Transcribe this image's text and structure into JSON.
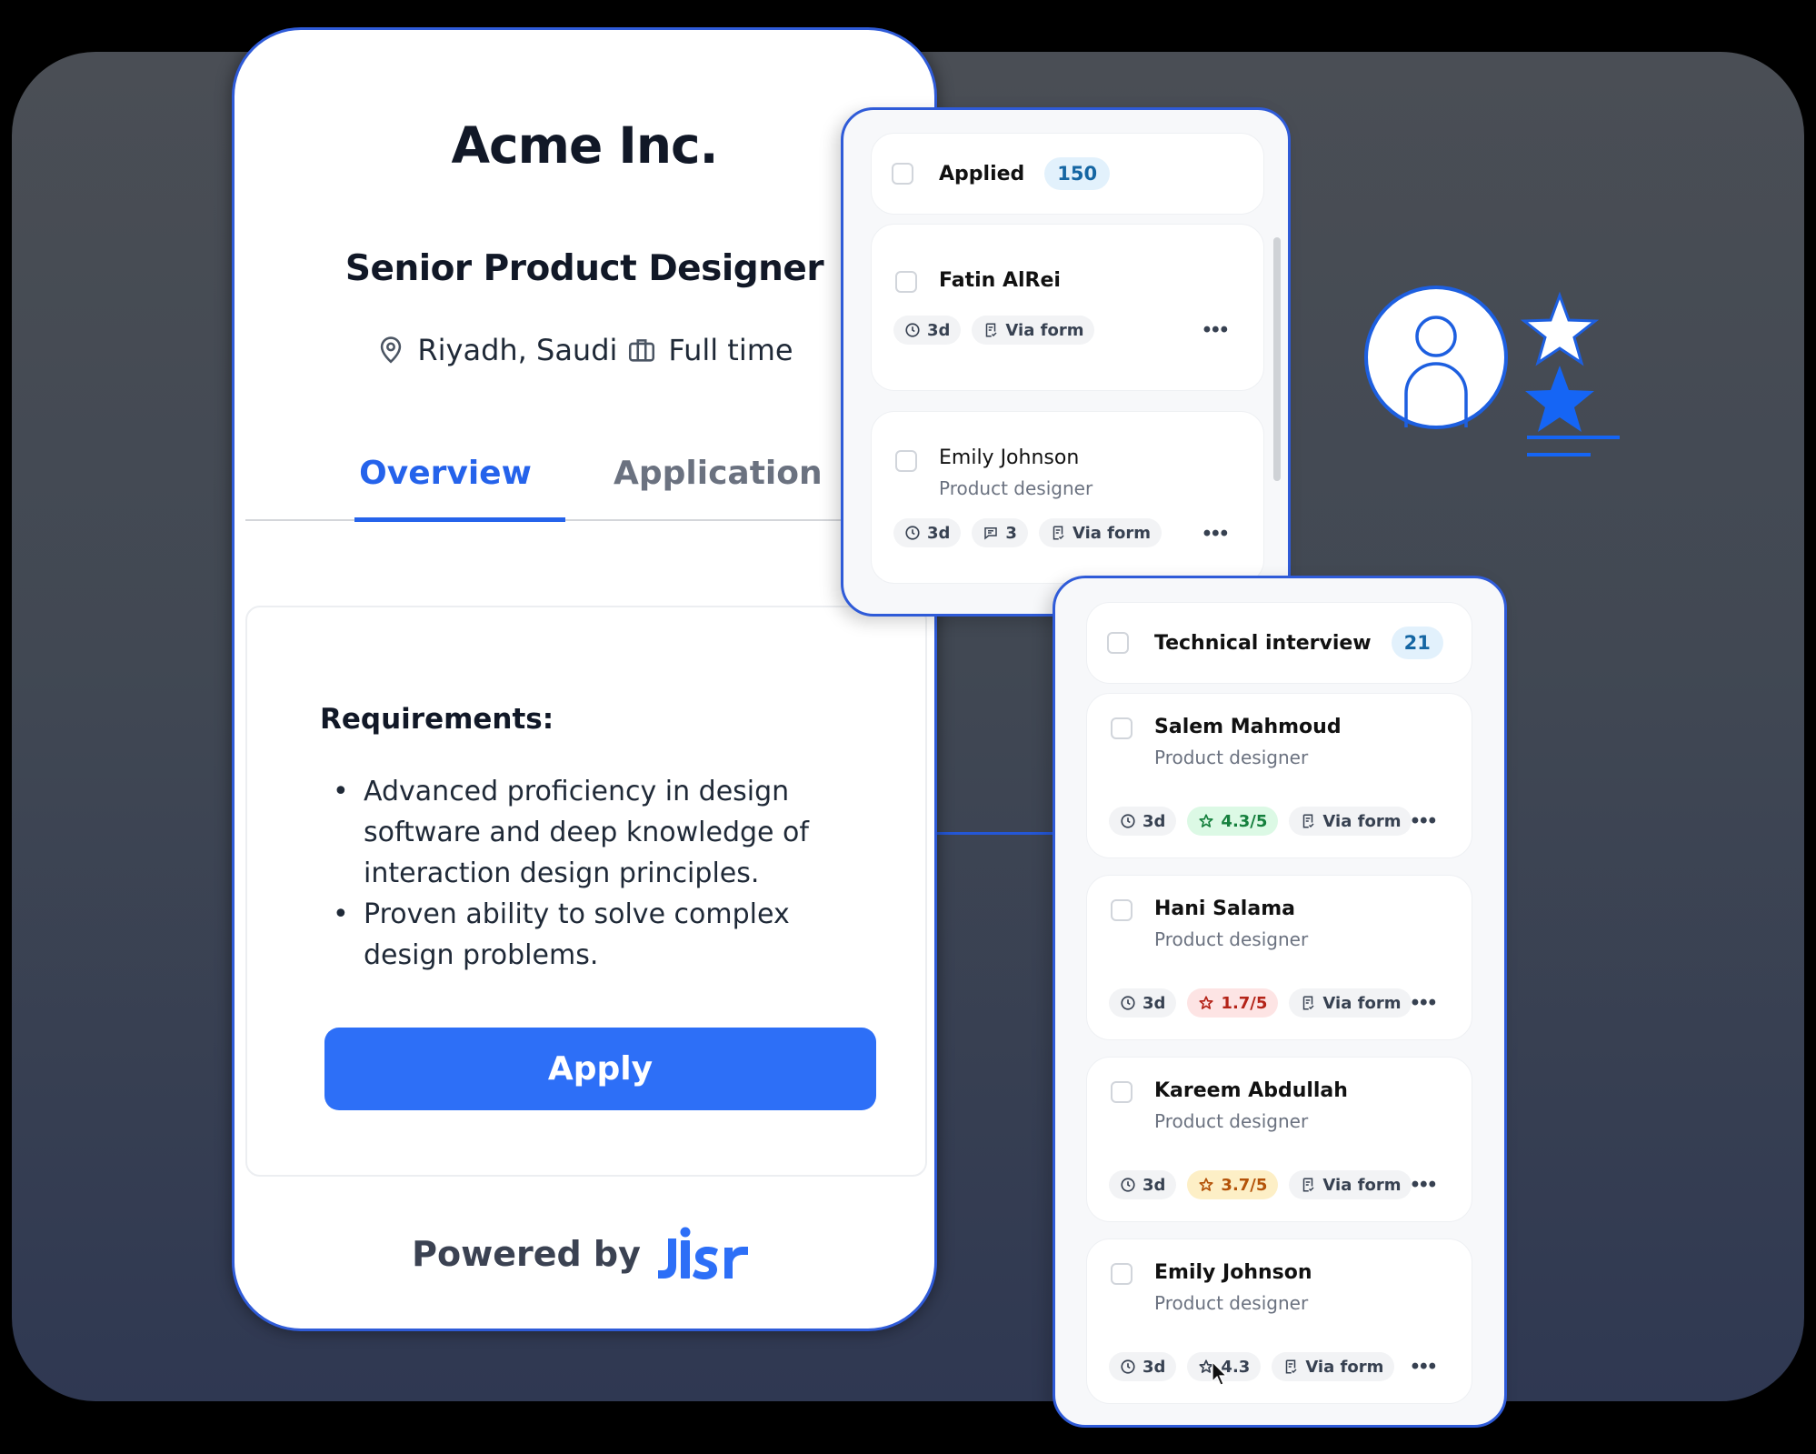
{
  "job": {
    "company": "Acme Inc.",
    "title": "Senior Product Designer",
    "location": "Riyadh, Saudi",
    "employment_type": "Full time",
    "tabs": [
      {
        "label": "Overview",
        "active": true
      },
      {
        "label": "Application",
        "active": false
      }
    ],
    "requirements_title": "Requirements:",
    "requirements": [
      "Advanced proficiency in design software and deep knowledge of interaction design principles.",
      "Proven ability to solve complex design problems."
    ],
    "apply_label": "Apply",
    "powered_by": "Powered by",
    "brand": "Jisr"
  },
  "pipeline": {
    "applied": {
      "stage": "Applied",
      "count": "150",
      "candidates": [
        {
          "name": "Fatin AlRei",
          "role": "",
          "tags": [
            {
              "icon": "clock-icon",
              "text": "3d"
            },
            {
              "icon": "form-icon",
              "text": "Via form"
            }
          ]
        },
        {
          "name": "Emily Johnson",
          "role": "Product designer",
          "tags": [
            {
              "icon": "clock-icon",
              "text": "3d"
            },
            {
              "icon": "comment-icon",
              "text": "3"
            },
            {
              "icon": "form-icon",
              "text": "Via form"
            }
          ]
        }
      ]
    },
    "technical_interview": {
      "stage": "Technical interview",
      "count": "21",
      "candidates": [
        {
          "name": "Salem Mahmoud",
          "role": "Product designer",
          "time": "3d",
          "rating": "4.3/5",
          "rating_color": "green",
          "source": "Via form"
        },
        {
          "name": "Hani Salama",
          "role": "Product designer",
          "time": "3d",
          "rating": "1.7/5",
          "rating_color": "red",
          "source": "Via form"
        },
        {
          "name": "Kareem Abdullah",
          "role": "Product designer",
          "time": "3d",
          "rating": "3.7/5",
          "rating_color": "amber",
          "source": "Via form"
        },
        {
          "name": "Emily Johnson",
          "role": "Product designer",
          "time": "3d",
          "rating": "4.3",
          "rating_color": "neutral",
          "source": "Via form"
        }
      ]
    },
    "more_label": "•••"
  },
  "colors": {
    "accent": "#2d6ff7",
    "border_accent": "#2f5bd8",
    "rating_green": "#15803d",
    "rating_red": "#b42318",
    "rating_amber": "#b45309"
  }
}
